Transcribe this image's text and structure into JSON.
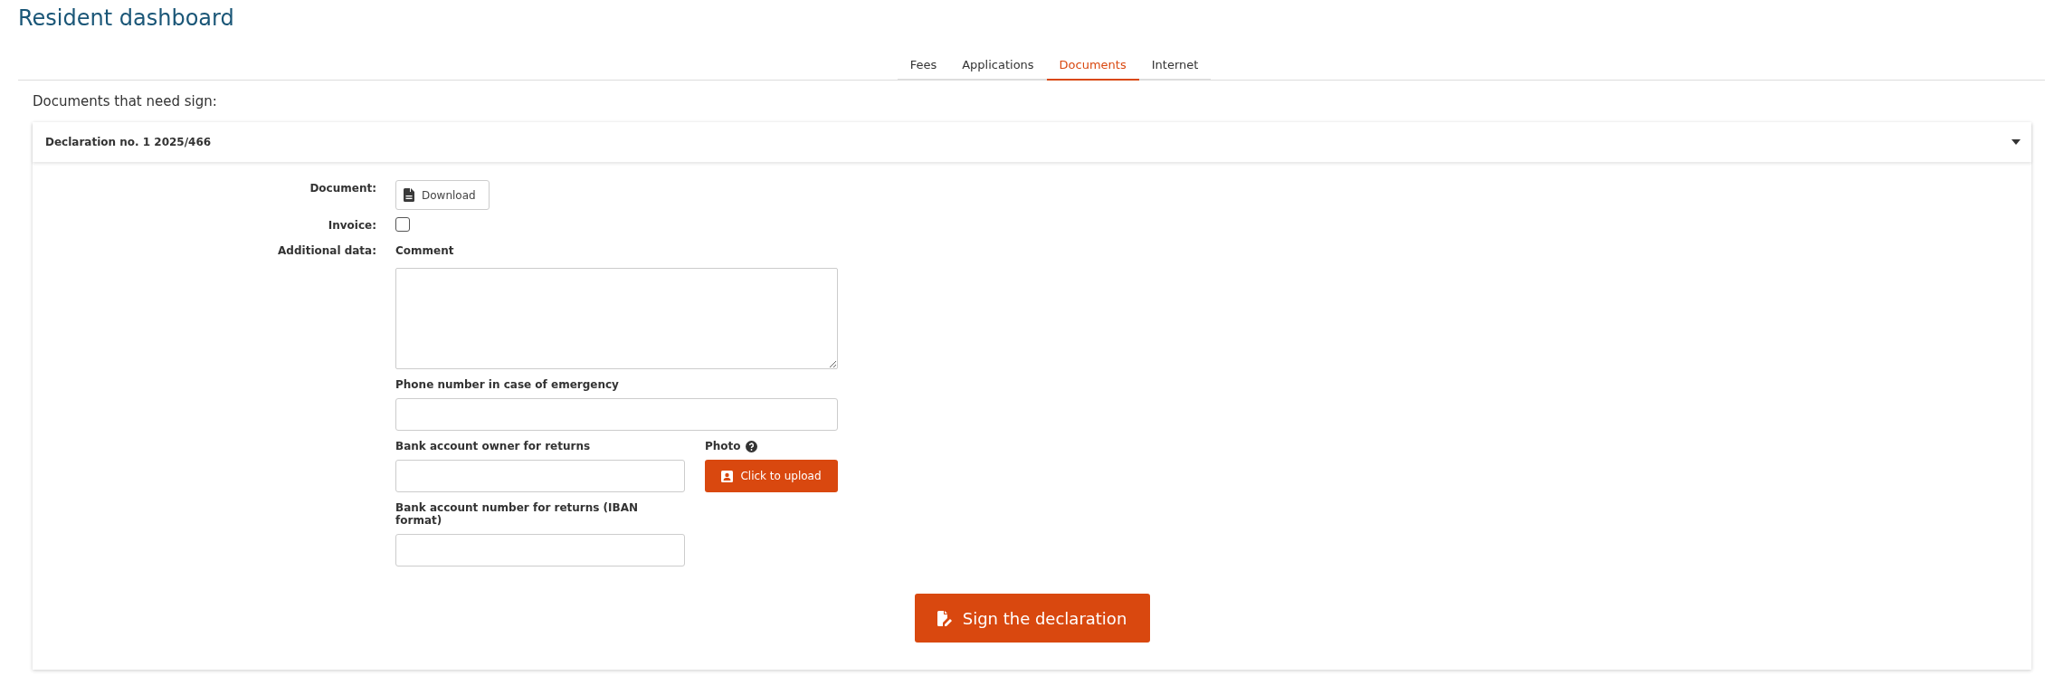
{
  "page": {
    "title": "Resident dashboard"
  },
  "tabs": [
    {
      "label": "Fees",
      "selected": false
    },
    {
      "label": "Applications",
      "selected": false
    },
    {
      "label": "Documents",
      "selected": true
    },
    {
      "label": "Internet",
      "selected": false
    }
  ],
  "section_heading": "Documents that need sign:",
  "panel": {
    "title": "Declaration no. 1 2025/466",
    "expanded": true,
    "document": {
      "label": "Document:",
      "button": "Download"
    },
    "invoice": {
      "label": "Invoice:",
      "checked": false
    },
    "additional": {
      "label": "Additional data:",
      "comment": {
        "label": "Comment"
      },
      "phone": {
        "label": "Phone number in case of emergency"
      },
      "bank_owner": {
        "label": "Bank account owner for returns"
      },
      "photo": {
        "label": "Photo",
        "button": "Click to upload"
      },
      "iban": {
        "label": "Bank account number for returns (IBAN format)"
      }
    },
    "sign_button": "Sign the declaration"
  }
}
